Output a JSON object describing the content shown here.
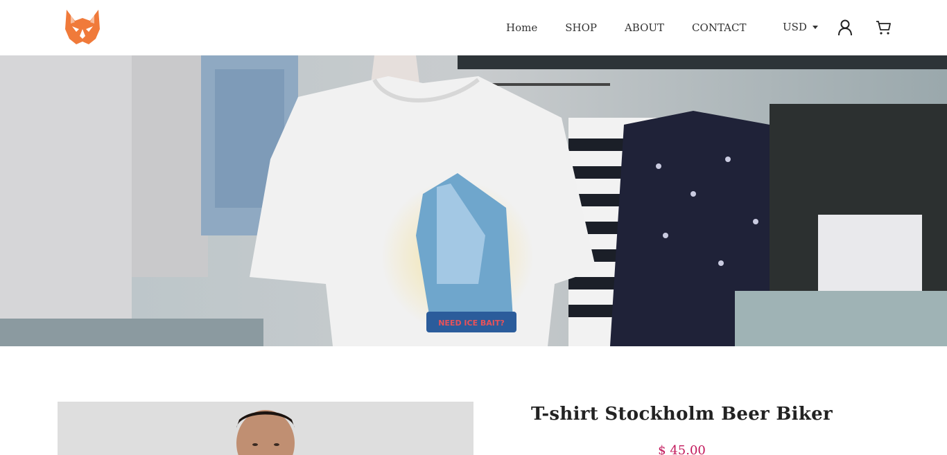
{
  "nav": {
    "links": [
      "Home",
      "SHOP",
      "ABOUT",
      "CONTACT"
    ],
    "currency": "USD"
  },
  "icons": {
    "logo": "lynx-logo",
    "user": "user-icon",
    "cart": "cart-icon",
    "currency_caret": "caret-down-icon"
  },
  "colors": {
    "brand_orange": "#f07a3a",
    "price": "#c2185b",
    "text": "#333333"
  },
  "product": {
    "title": "T-shirt Stockholm Beer Biker",
    "price": "$ 45.00",
    "shirt_print_text": "NEED ICE BAIT?"
  }
}
